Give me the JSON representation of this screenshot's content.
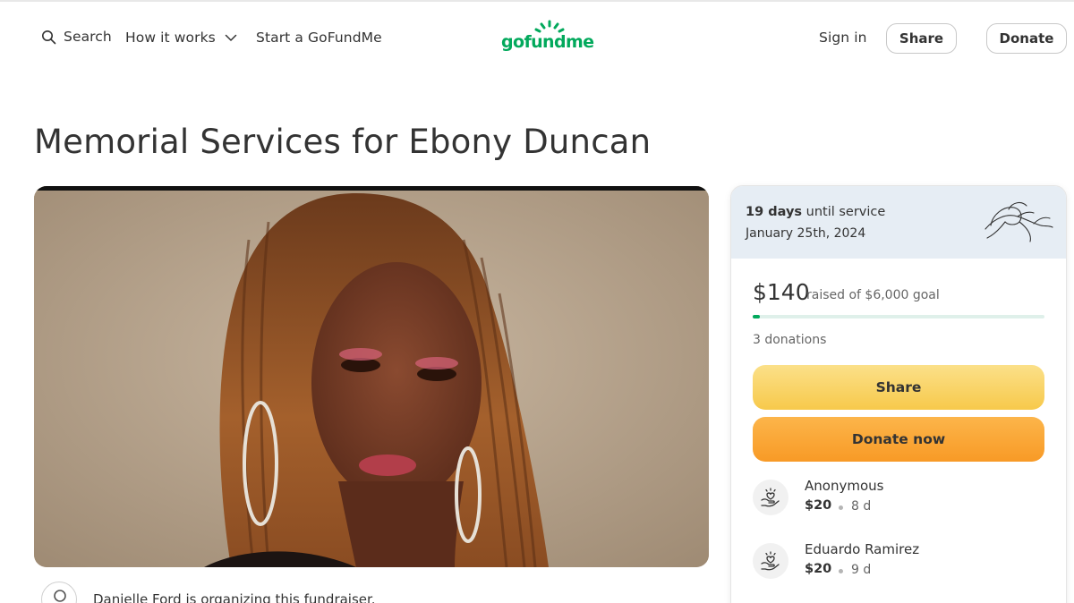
{
  "nav": {
    "search_label": "Search",
    "how_label": "How it works",
    "start_label": "Start a GoFundMe",
    "logo_text": "gofundme",
    "signin_label": "Sign in",
    "share_label": "Share",
    "donate_label": "Donate"
  },
  "title": "Memorial Services for Ebony Duncan",
  "service": {
    "days": "19 days",
    "until": "until service",
    "date": "January 25th, 2024"
  },
  "fundraiser": {
    "raised": "$140",
    "goal_text": "raised of $6,000 goal",
    "progress_fraction": 0.0233,
    "donations": "3 donations",
    "share_button": "Share",
    "donate_button": "Donate now"
  },
  "donors": [
    {
      "name": "Anonymous",
      "amount": "$20",
      "time": "8 d"
    },
    {
      "name": "Eduardo Ramirez",
      "amount": "$20",
      "time": "9 d"
    }
  ],
  "organizer": {
    "text": "Danielle Ford is organizing this fundraiser."
  },
  "colors": {
    "brand_green": "#02a95c",
    "share_yellow": "#f7c94b",
    "donate_orange": "#f89a26",
    "service_banner": "#e6edf4"
  }
}
